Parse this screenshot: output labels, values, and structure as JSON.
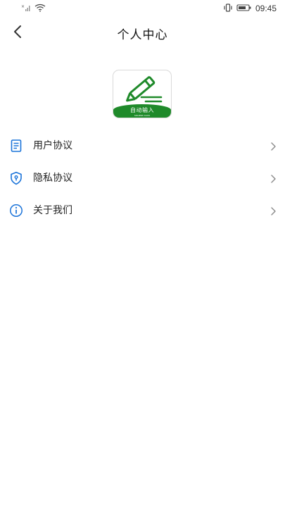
{
  "status_bar": {
    "time": "09:45",
    "icons": [
      "signal-icon",
      "wifi-icon",
      "vibrate-icon",
      "battery-icon"
    ]
  },
  "nav": {
    "back_icon": "chevron-left-icon",
    "title": "个人中心"
  },
  "logo": {
    "label": "自动输入",
    "sublabel": "SOLPAIR CLICK",
    "colors": {
      "primary": "#1f8a2a",
      "border": "#d9d9d9"
    }
  },
  "menu": {
    "items": [
      {
        "label": "用户协议",
        "icon": "document-icon"
      },
      {
        "label": "隐私协议",
        "icon": "shield-icon"
      },
      {
        "label": "关于我们",
        "icon": "info-icon"
      }
    ],
    "accent_color": "#1a73d9"
  }
}
